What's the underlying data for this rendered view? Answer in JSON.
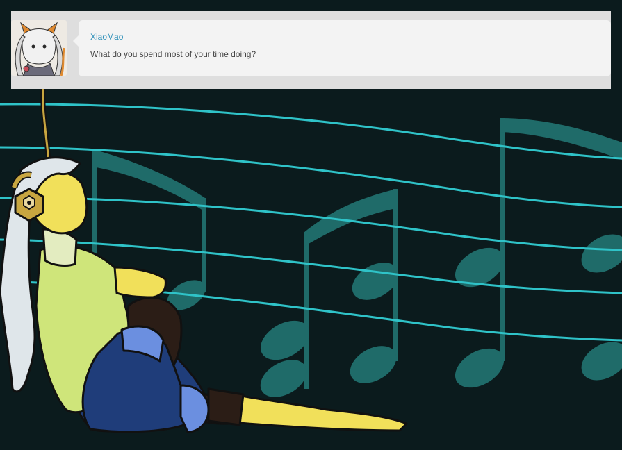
{
  "ask": {
    "asker_name": "XiaoMao",
    "question": "What do you spend most of your time doing?"
  },
  "avatar": {
    "icon": "fox-character-avatar"
  },
  "artwork": {
    "subject": "character-with-headphones-sitting",
    "background": "music-staff-with-notes",
    "colors": {
      "background": "#0b1b1d",
      "staff_lines": "#2fc3c8",
      "notes": "#1f6b69",
      "skin": "#f1e05a",
      "shirt": "#cfe57a",
      "shorts": "#1f3d7a",
      "hair": "#dfe6ea"
    }
  }
}
